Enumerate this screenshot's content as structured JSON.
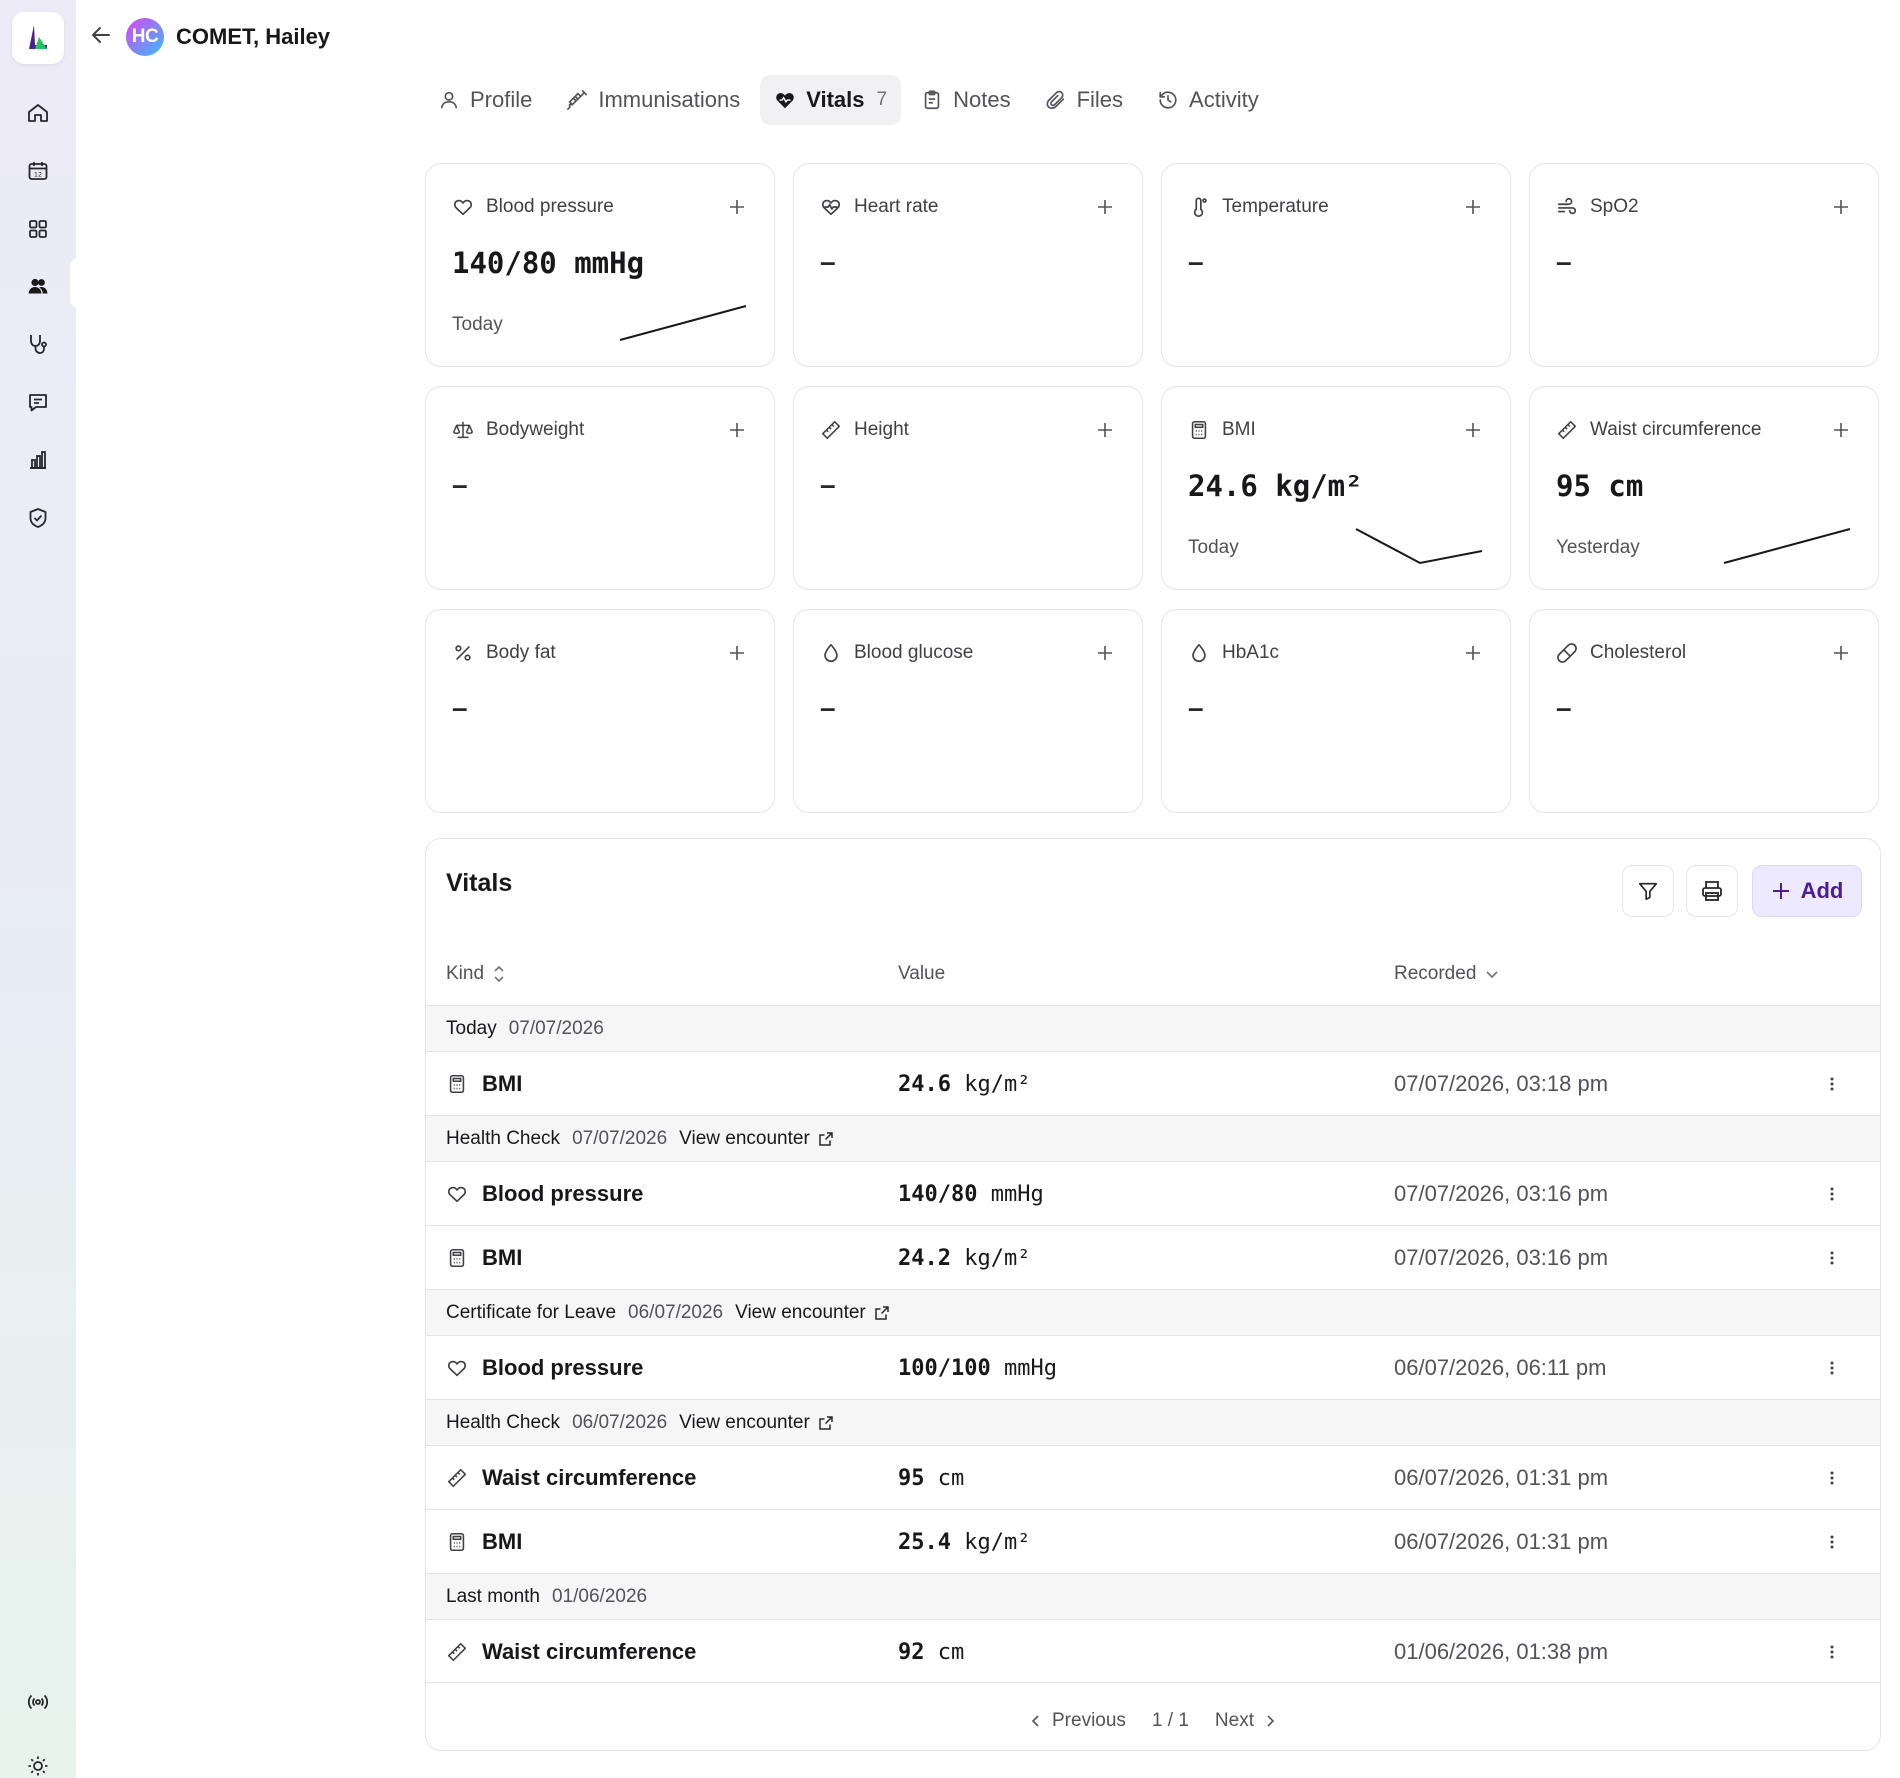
{
  "sidebar": {
    "logo": "logo-mark",
    "nav": [
      {
        "name": "home-icon"
      },
      {
        "name": "calendar-icon"
      },
      {
        "name": "apps-grid-icon"
      },
      {
        "name": "patients-icon",
        "active": true
      },
      {
        "name": "stethoscope-icon"
      },
      {
        "name": "messages-icon"
      },
      {
        "name": "reports-icon"
      },
      {
        "name": "shield-check-icon"
      }
    ],
    "bottom": [
      {
        "name": "broadcast-icon"
      },
      {
        "name": "theme-sun-icon"
      }
    ]
  },
  "header": {
    "avatar_initials": "HC",
    "patient_name": "COMET, Hailey"
  },
  "tabs": [
    {
      "label": "Profile",
      "icon": "user-icon"
    },
    {
      "label": "Immunisations",
      "icon": "syringe-icon"
    },
    {
      "label": "Vitals",
      "icon": "heart-icon",
      "count": "7",
      "active": true
    },
    {
      "label": "Notes",
      "icon": "clipboard-icon"
    },
    {
      "label": "Files",
      "icon": "paperclip-icon"
    },
    {
      "label": "Activity",
      "icon": "history-icon"
    }
  ],
  "cards": [
    {
      "title": "Blood pressure",
      "icon": "heart-icon",
      "value": "140/80 mmHg",
      "date": "Today"
    },
    {
      "title": "Heart rate",
      "icon": "heart-pulse-icon",
      "value": "–"
    },
    {
      "title": "Temperature",
      "icon": "thermometer-icon",
      "value": "–"
    },
    {
      "title": "SpO2",
      "icon": "wind-icon",
      "value": "–"
    },
    {
      "title": "Bodyweight",
      "icon": "scale-icon",
      "value": "–"
    },
    {
      "title": "Height",
      "icon": "ruler-icon",
      "value": "–"
    },
    {
      "title": "BMI",
      "icon": "calculator-icon",
      "value": "24.6 kg/m²",
      "date": "Today"
    },
    {
      "title": "Waist circumference",
      "icon": "ruler-icon",
      "value": "95 cm",
      "date": "Yesterday"
    },
    {
      "title": "Body fat",
      "icon": "percent-icon",
      "value": "–"
    },
    {
      "title": "Blood glucose",
      "icon": "droplet-icon",
      "value": "–"
    },
    {
      "title": "HbA1c",
      "icon": "droplet-icon",
      "value": "–"
    },
    {
      "title": "Cholesterol",
      "icon": "pill-icon",
      "value": "–"
    }
  ],
  "vitals": {
    "title": "Vitals",
    "add_label": "Add",
    "columns": {
      "kind": "Kind",
      "value": "Value",
      "recorded": "Recorded"
    },
    "groups": [
      {
        "label": "Today",
        "date": "07/07/2026"
      },
      {
        "label": "Health Check",
        "date": "07/07/2026",
        "link": "View encounter"
      },
      {
        "label": "Certificate for Leave",
        "date": "06/07/2026",
        "link": "View encounter"
      },
      {
        "label": "Health Check",
        "date": "06/07/2026",
        "link": "View encounter"
      },
      {
        "label": "Last month",
        "date": "01/06/2026"
      }
    ],
    "rows": [
      {
        "kind": "BMI",
        "value": "24.6",
        "unit": "kg/m²",
        "recorded": "07/07/2026, 03:18 pm"
      },
      {
        "kind": "Blood pressure",
        "value": "140/80",
        "unit": "mmHg",
        "recorded": "07/07/2026, 03:16 pm"
      },
      {
        "kind": "BMI",
        "value": "24.2",
        "unit": "kg/m²",
        "recorded": "07/07/2026, 03:16 pm"
      },
      {
        "kind": "Blood pressure",
        "value": "100/100",
        "unit": "mmHg",
        "recorded": "06/07/2026, 06:11 pm"
      },
      {
        "kind": "Waist circumference",
        "value": "95",
        "unit": "cm",
        "recorded": "06/07/2026, 01:31 pm"
      },
      {
        "kind": "BMI",
        "value": "25.4",
        "unit": "kg/m²",
        "recorded": "06/07/2026, 01:31 pm"
      },
      {
        "kind": "Waist circumference",
        "value": "92",
        "unit": "cm",
        "recorded": "01/06/2026, 01:38 pm"
      }
    ],
    "pagination": {
      "previous": "Previous",
      "page": "1 / 1",
      "next": "Next"
    }
  },
  "colors": {
    "accent": "#4c1d95",
    "accent_bg": "#ede9fe",
    "border": "#e4e4e7"
  }
}
